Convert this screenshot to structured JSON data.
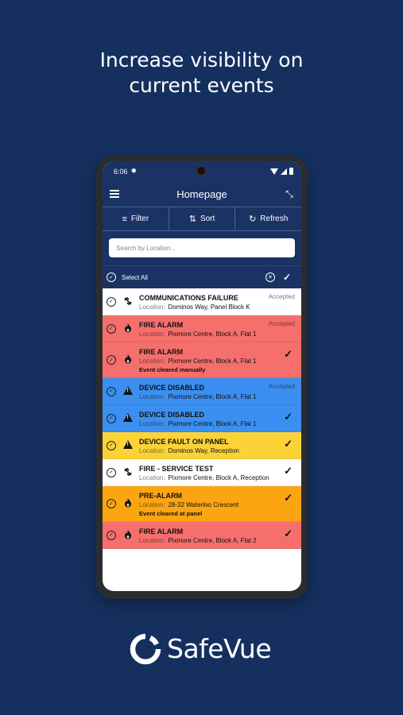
{
  "headline": {
    "line1": "Increase visibility on",
    "line2": "current events"
  },
  "status_bar": {
    "time": "6:06"
  },
  "app_bar": {
    "title": "Homepage"
  },
  "toolbar": {
    "filter_label": "Filter",
    "sort_label": "Sort",
    "refresh_label": "Refresh"
  },
  "search": {
    "placeholder": "Search by Location..."
  },
  "select_bar": {
    "label": "Select All"
  },
  "location_label": "Location:",
  "events": [
    {
      "title": "COMMUNICATIONS FAILURE",
      "location": "Dominos Way, Panel Block K",
      "status": "Accepted",
      "note": "",
      "color": "#ffffff",
      "icon": "comms-failure-icon"
    },
    {
      "title": "FIRE ALARM",
      "location": "Pixmore Centre, Block A, Flat 1",
      "status": "Accepted",
      "note": "",
      "color": "#f56f6c",
      "icon": "flame-icon"
    },
    {
      "title": "FIRE ALARM",
      "location": "Pixmore Centre, Block A, Flat 1",
      "status": "",
      "note": "Event cleared manually",
      "color": "#f56f6c",
      "icon": "flame-icon"
    },
    {
      "title": "DEVICE DISABLED",
      "location": "Pixmore Centre, Block A, Flat 1",
      "status": "Accepted",
      "note": "",
      "color": "#3b8ff0",
      "icon": "warning-icon"
    },
    {
      "title": "DEVICE DISABLED",
      "location": "Pixmore Centre, Block A, Flat 1",
      "status": "",
      "note": "",
      "color": "#3b8ff0",
      "icon": "warning-icon"
    },
    {
      "title": "DEVICE FAULT ON PANEL",
      "location": "Dominos Way, Reception",
      "status": "",
      "note": "",
      "color": "#fbd337",
      "icon": "warning-icon"
    },
    {
      "title": "FIRE - SERVICE TEST",
      "location": "Pixmore Centre, Block A, Reception",
      "status": "",
      "note": "",
      "color": "#ffffff",
      "icon": "comms-failure-icon"
    },
    {
      "title": "PRE-ALARM",
      "location": "28-32 Waterloo Crescent",
      "status": "",
      "note": "Event cleared at panel",
      "color": "#fca512",
      "icon": "flame-icon"
    },
    {
      "title": "FIRE ALARM",
      "location": "Pixmore Centre, Block A, Flat 2",
      "status": "",
      "note": "",
      "color": "#f56f6c",
      "icon": "flame-icon"
    }
  ],
  "brand": {
    "name_part1": "Safe",
    "name_part2": "Vue"
  },
  "colors": {
    "background": "#15305f",
    "app_bar": "#1b3264"
  }
}
